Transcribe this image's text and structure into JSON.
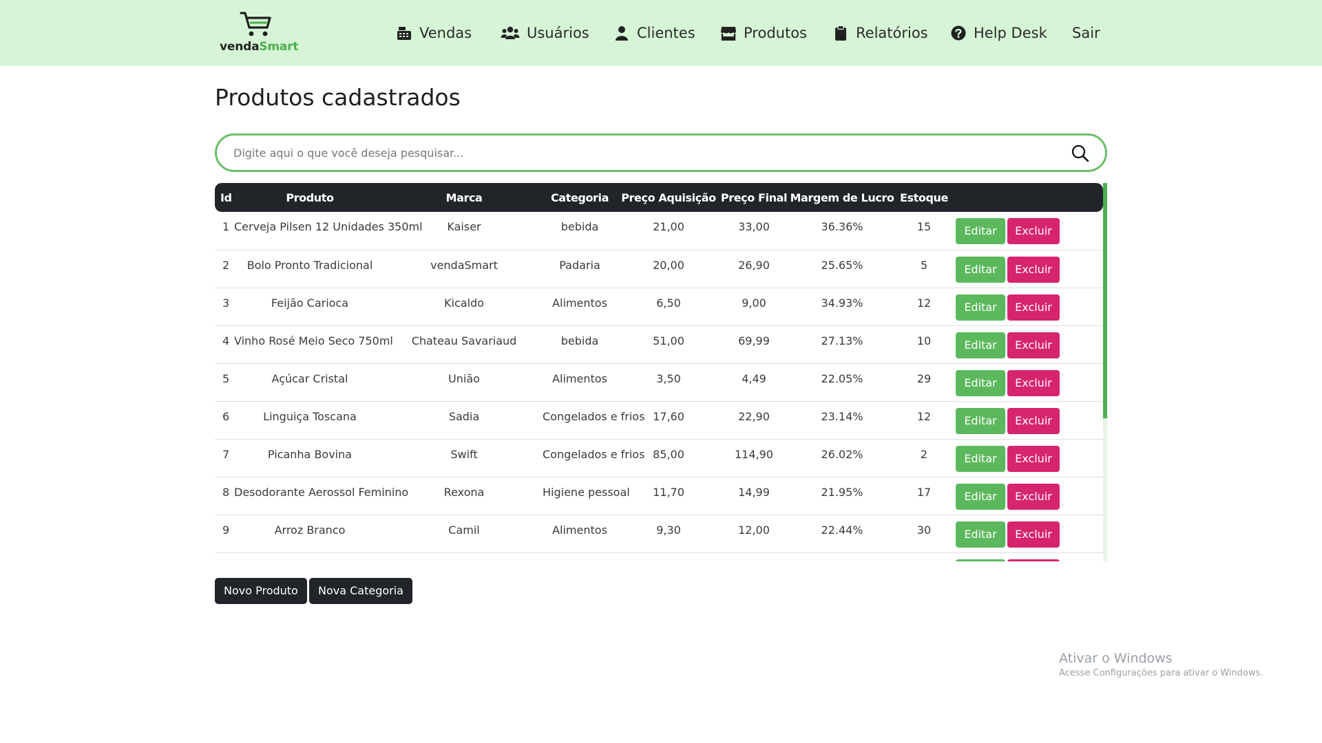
{
  "brand": {
    "logo_part1": "venda",
    "logo_part2": "Smart"
  },
  "nav": {
    "items": [
      {
        "label": "Vendas",
        "icon": "cash-register-icon"
      },
      {
        "label": "Usuários",
        "icon": "users-icon"
      },
      {
        "label": "Clientes",
        "icon": "user-icon"
      },
      {
        "label": "Produtos",
        "icon": "store-icon"
      },
      {
        "label": "Relatórios",
        "icon": "clipboard-icon"
      },
      {
        "label": "Help Desk",
        "icon": "question-circle-icon"
      },
      {
        "label": "Sair",
        "icon": ""
      }
    ]
  },
  "page": {
    "title": "Produtos cadastrados"
  },
  "search": {
    "placeholder": "Digite aqui o que você deseja pesquisar...",
    "icon": "search-icon"
  },
  "table": {
    "headers": [
      "Id",
      "Produto",
      "Marca",
      "Categoria",
      "Preço Aquisição",
      "Preço Final",
      "Margem de Lucro",
      "Estoque",
      ""
    ],
    "edit_label": "Editar",
    "delete_label": "Excluir",
    "rows": [
      [
        "1",
        "Cerveja Pilsen 12 Unidades 350ml",
        "Kaiser",
        "bebida",
        "21,00",
        "33,00",
        "36.36%",
        "15"
      ],
      [
        "2",
        "Bolo Pronto Tradicional",
        "vendaSmart",
        "Padaria",
        "20,00",
        "26,90",
        "25.65%",
        "5"
      ],
      [
        "3",
        "Feijão Carioca",
        "Kicaldo",
        "Alimentos",
        "6,50",
        "9,00",
        "34.93%",
        "12"
      ],
      [
        "4",
        "Vinho Rosé Meio Seco 750ml",
        "Chateau Savariaud",
        "bebida",
        "51,00",
        "69,99",
        "27.13%",
        "10"
      ],
      [
        "5",
        "Açúcar Cristal",
        "União",
        "Alimentos",
        "3,50",
        "4,49",
        "22.05%",
        "29"
      ],
      [
        "6",
        "Linguiça Toscana",
        "Sadia",
        "Congelados e frios",
        "17,60",
        "22,90",
        "23.14%",
        "12"
      ],
      [
        "7",
        "Picanha Bovina",
        "Swift",
        "Congelados e frios",
        "85,00",
        "114,90",
        "26.02%",
        "2"
      ],
      [
        "8",
        "Desodorante Aerossol Feminino",
        "Rexona",
        "Higiene pessoal",
        "11,70",
        "14,99",
        "21.95%",
        "17"
      ],
      [
        "9",
        "Arroz Branco",
        "Camil",
        "Alimentos",
        "9,30",
        "12,00",
        "22.44%",
        "30"
      ],
      [
        "",
        "",
        "",
        "",
        "",
        "",
        "",
        ""
      ]
    ]
  },
  "actions": {
    "new_product": "Novo Produto",
    "new_category": "Nova Categoria"
  },
  "watermark": {
    "line1": "Ativar o Windows",
    "line2": "Acesse Configurações para ativar o Windows."
  },
  "colors": {
    "navbar_bg": "#d6f5d6",
    "accent_green": "#5cb85c",
    "danger_pink": "#d6246e",
    "dark": "#212529"
  }
}
